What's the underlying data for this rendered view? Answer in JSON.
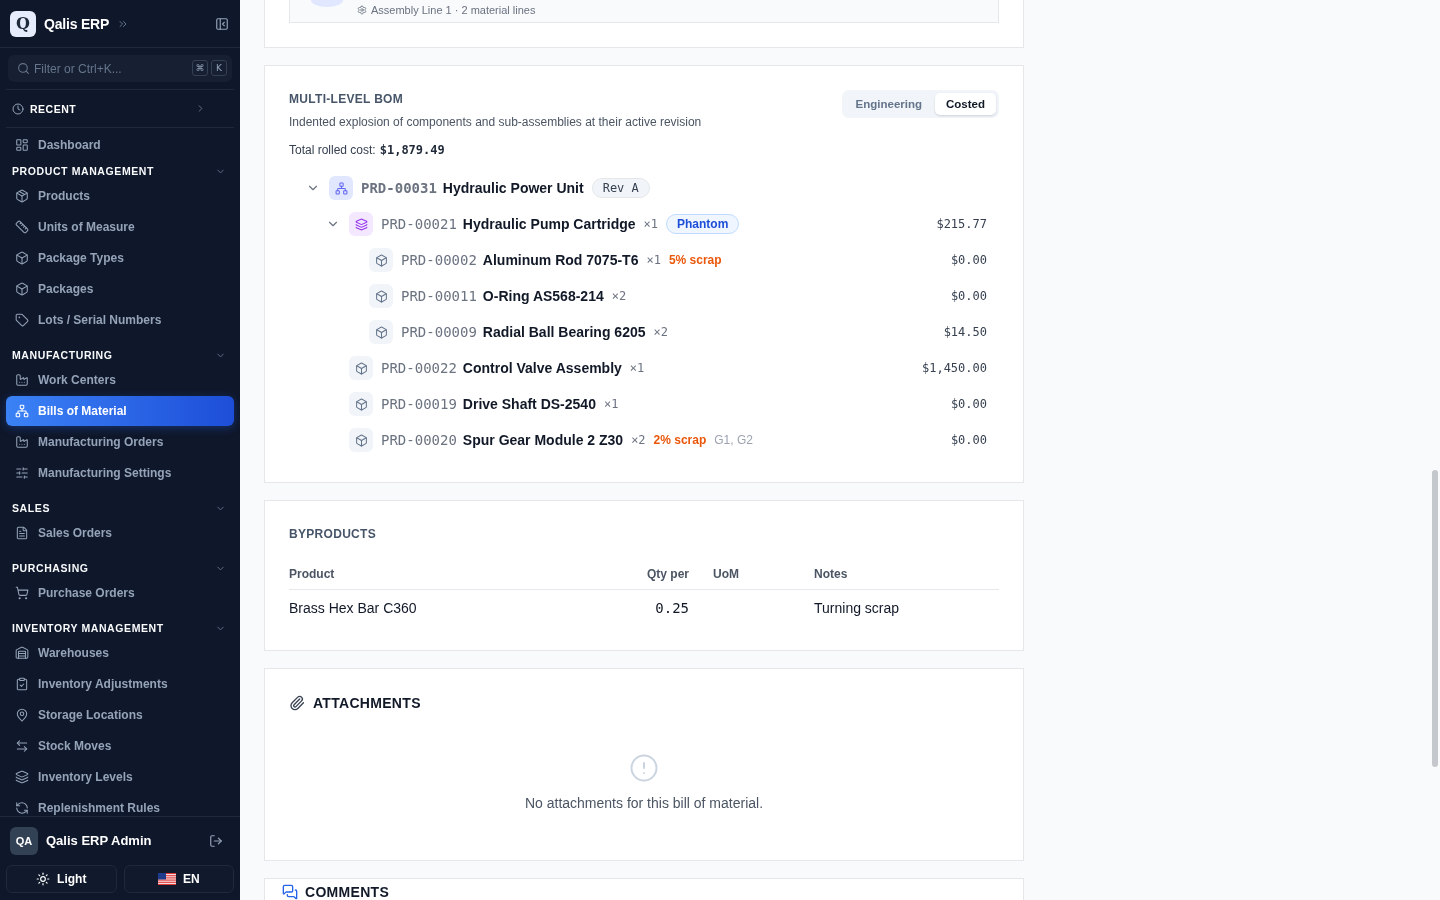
{
  "sidebar": {
    "logo": "Q",
    "brand": "Qalis ERP",
    "search": {
      "placeholder": "Filter or Ctrl+K...",
      "keys": [
        "⌘",
        "K"
      ]
    },
    "recent": {
      "label": "RECENT",
      "expanded": false
    },
    "items": [
      {
        "label": "Dashboard",
        "selected": false
      }
    ],
    "sections": [
      {
        "title": "PRODUCT MANAGEMENT",
        "expanded": true,
        "items": [
          {
            "label": "Products",
            "selected": false
          },
          {
            "label": "Units of Measure",
            "selected": false
          },
          {
            "label": "Package Types",
            "selected": false
          },
          {
            "label": "Packages",
            "selected": false
          },
          {
            "label": "Lots / Serial Numbers",
            "selected": false
          }
        ]
      },
      {
        "title": "MANUFACTURING",
        "expanded": true,
        "items": [
          {
            "label": "Work Centers",
            "selected": false
          },
          {
            "label": "Bills of Material",
            "selected": true
          },
          {
            "label": "Manufacturing Orders",
            "selected": false
          },
          {
            "label": "Manufacturing Settings",
            "selected": false
          }
        ]
      },
      {
        "title": "SALES",
        "expanded": true,
        "items": [
          {
            "label": "Sales Orders",
            "selected": false
          }
        ]
      },
      {
        "title": "PURCHASING",
        "expanded": true,
        "items": [
          {
            "label": "Purchase Orders",
            "selected": false
          }
        ]
      },
      {
        "title": "INVENTORY MANAGEMENT",
        "expanded": true,
        "items": [
          {
            "label": "Warehouses",
            "selected": false
          },
          {
            "label": "Inventory Adjustments",
            "selected": false
          },
          {
            "label": "Storage Locations",
            "selected": false
          },
          {
            "label": "Stock Moves",
            "selected": false
          },
          {
            "label": "Inventory Levels",
            "selected": false
          },
          {
            "label": "Replenishment Rules",
            "selected": false
          }
        ]
      }
    ],
    "user": {
      "initials": "QA",
      "name": "Qalis ERP Admin"
    },
    "theme_button": "Light",
    "language_button": "EN"
  },
  "header_card": {
    "meta": "Assembly Line 1 · 2 material lines"
  },
  "bom": {
    "title": "MULTI-LEVEL BOM",
    "subtitle": "Indented explosion of components and sub-assemblies at their active revision",
    "total_label": "Total rolled cost:",
    "total_value": "$1,879.49",
    "view_toggle": [
      {
        "label": "Engineering",
        "selected": false
      },
      {
        "label": "Costed",
        "selected": true
      }
    ],
    "tree": [
      {
        "kind": "assembly",
        "code": "PRD-00031",
        "name": "Hydraulic Power Unit",
        "revision": "Rev A",
        "expanded": true,
        "children": [
          {
            "kind": "phantom",
            "code": "PRD-00021",
            "name": "Hydraulic Pump Cartridge",
            "qty": "×1",
            "tag": "Phantom",
            "cost": "$215.77",
            "expanded": true,
            "children": [
              {
                "kind": "component",
                "code": "PRD-00002",
                "name": "Aluminum Rod 7075-T6",
                "qty": "×1",
                "scrap": "5% scrap",
                "cost": "$0.00"
              },
              {
                "kind": "component",
                "code": "PRD-00011",
                "name": "O-Ring AS568-214",
                "qty": "×2",
                "cost": "$0.00"
              },
              {
                "kind": "component",
                "code": "PRD-00009",
                "name": "Radial Ball Bearing 6205",
                "qty": "×2",
                "cost": "$14.50"
              }
            ]
          },
          {
            "kind": "component",
            "code": "PRD-00022",
            "name": "Control Valve Assembly",
            "qty": "×1",
            "cost": "$1,450.00"
          },
          {
            "kind": "component",
            "code": "PRD-00019",
            "name": "Drive Shaft DS-2540",
            "qty": "×1",
            "cost": "$0.00"
          },
          {
            "kind": "component",
            "code": "PRD-00020",
            "name": "Spur Gear Module 2 Z30",
            "qty": "×2",
            "scrap": "2% scrap",
            "note": "G1, G2",
            "cost": "$0.00"
          }
        ]
      }
    ]
  },
  "byproducts": {
    "title": "BYPRODUCTS",
    "columns": [
      "Product",
      "Qty per",
      "UoM",
      "Notes"
    ],
    "rows": [
      {
        "product": "Brass Hex Bar C360",
        "qty_per": "0.25",
        "notes": "Turning scrap"
      }
    ]
  },
  "attachments": {
    "title": "ATTACHMENTS",
    "empty_message": "No attachments for this bill of material."
  },
  "comments": {
    "title": "COMMENTS"
  }
}
